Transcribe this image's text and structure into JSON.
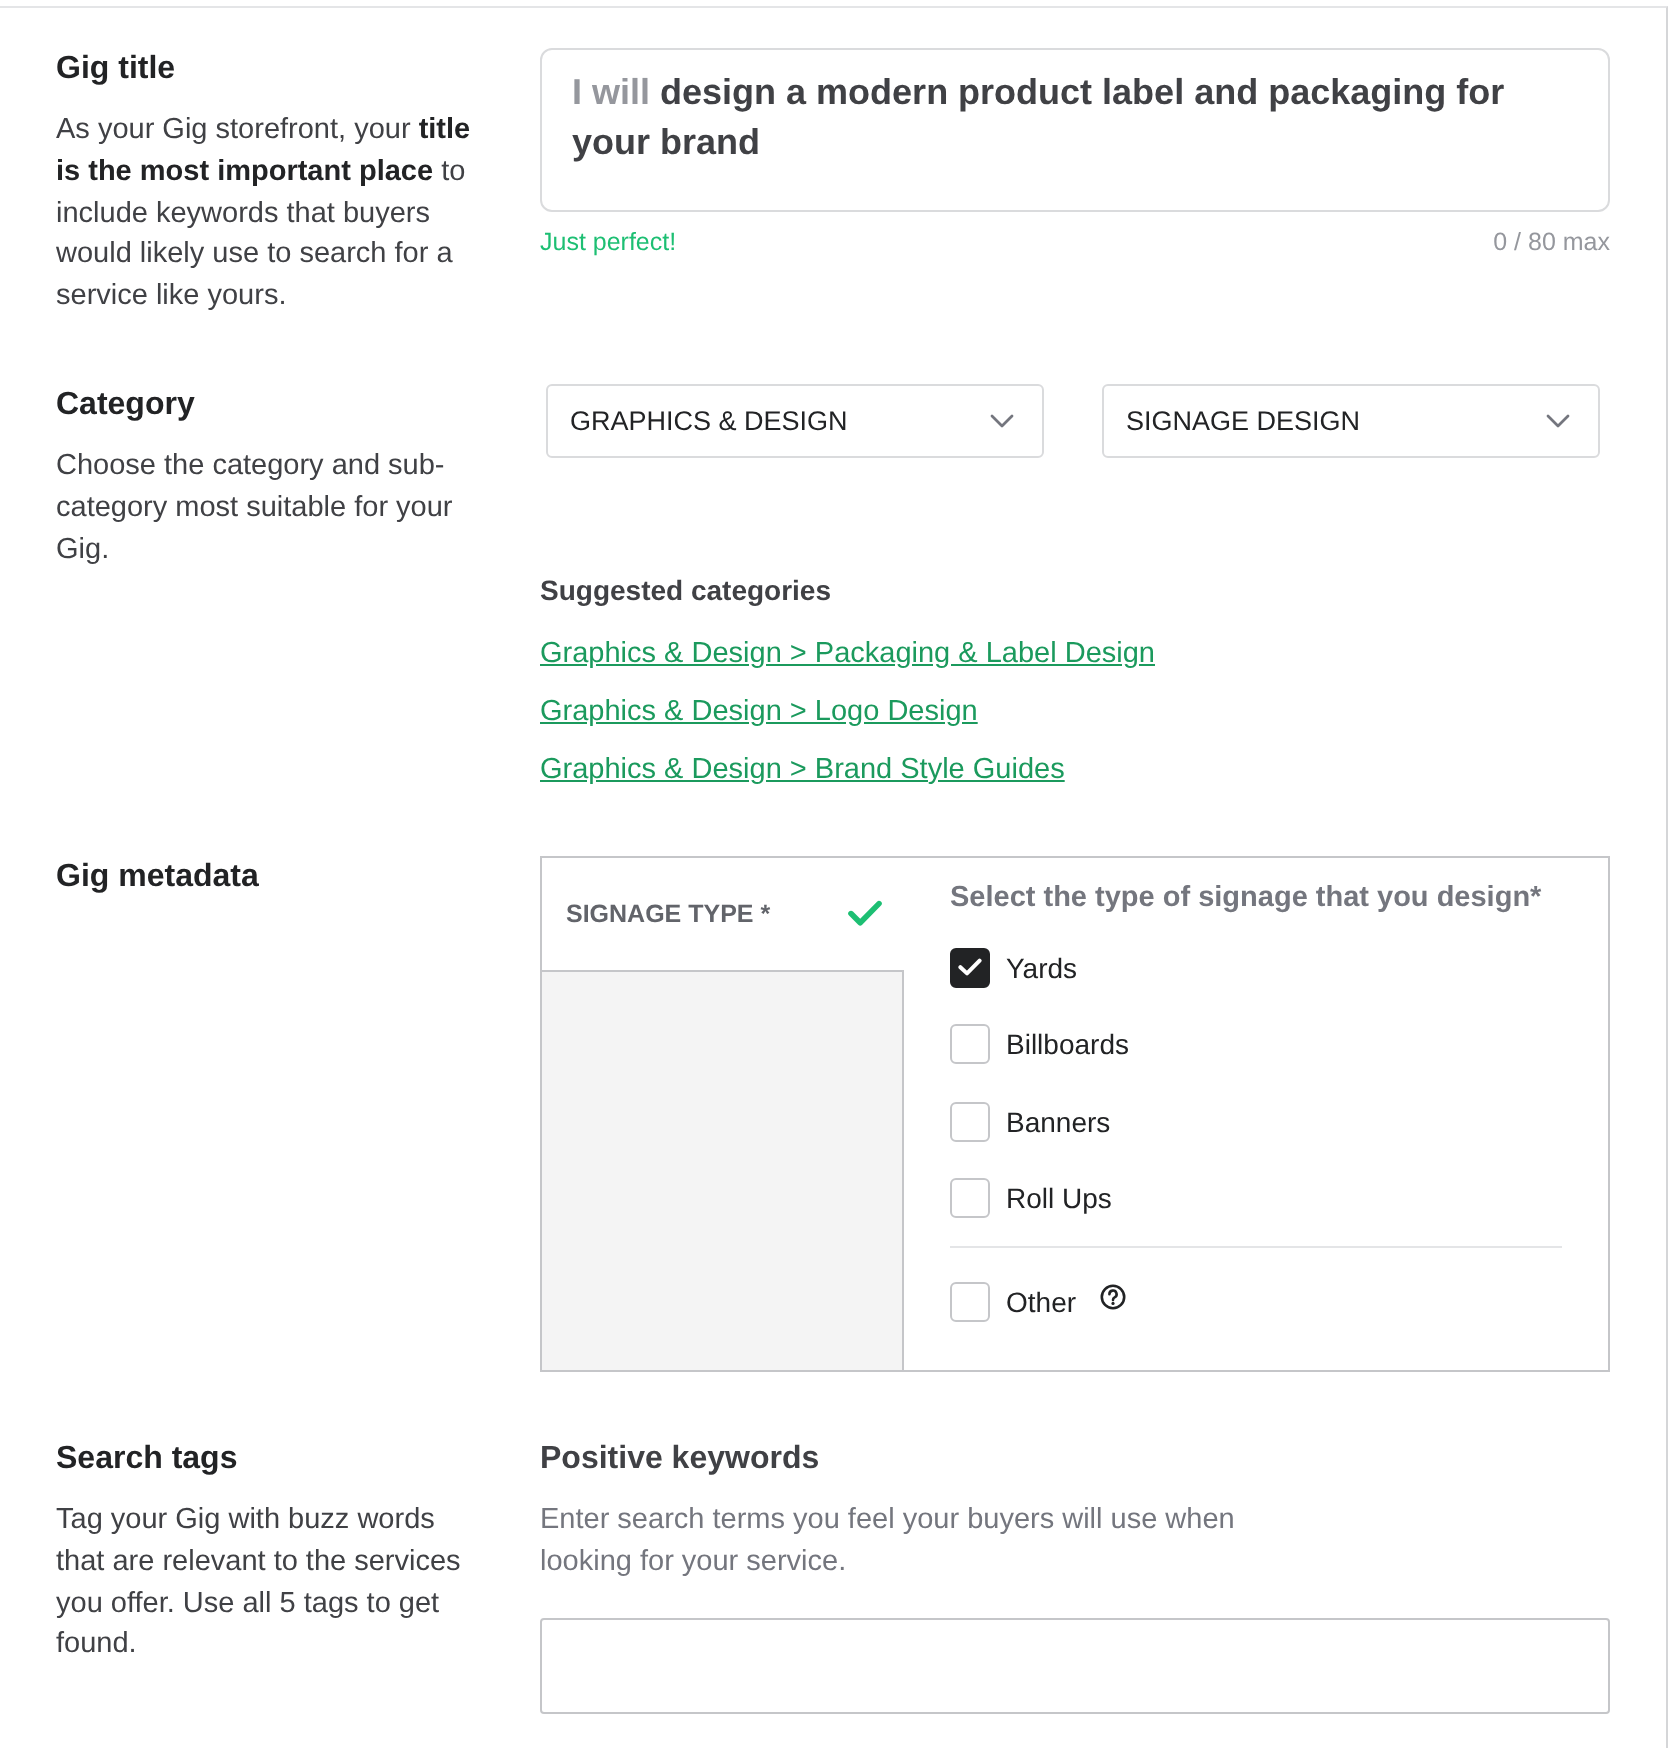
{
  "sections": [
    {
      "kind": "title",
      "heading": "Gig title",
      "description": "As your Gig storefront, your **title is the most important place** to include keywords that buyers would likely use to search for a service like yours.",
      "field": {
        "prefix": "I will",
        "value": "design a modern product label and packaging for your brand"
      },
      "hint": "Just perfect!",
      "counter": "0 / 80 max"
    },
    {
      "kind": "category",
      "heading": "Category",
      "description": "Choose the category and sub-category most suitable for your Gig.",
      "dropdowns": [
        {
          "value": "GRAPHICS & DESIGN"
        },
        {
          "value": "SIGNAGE DESIGN"
        }
      ],
      "suggested": {
        "title": "Suggested categories",
        "links": [
          "Graphics & Design > Packaging & Label Design",
          "Graphics & Design > Logo Design",
          "Graphics & Design > Brand Style Guides"
        ]
      }
    },
    {
      "kind": "metadata",
      "heading": "Gig metadata",
      "tabs": [
        {
          "label": "SIGNAGE TYPE *",
          "selected": true,
          "complete": true
        }
      ],
      "question": "Select the type of signage that you design*",
      "options": [
        {
          "kind": "option",
          "label": "Yards",
          "checked": true
        },
        {
          "kind": "option",
          "label": "Billboards",
          "checked": false
        },
        {
          "kind": "option",
          "label": "Banners",
          "checked": false
        },
        {
          "kind": "option",
          "label": "Roll Ups",
          "checked": false
        },
        {
          "kind": "other",
          "label": "Other",
          "checked": false
        }
      ]
    },
    {
      "kind": "tags",
      "heading": "Search tags",
      "description": "Tag your Gig with buzz words that are relevant to the services you offer. Use all 5 tags to get found.",
      "subheading": "Positive keywords",
      "subdescription": "Enter search terms you feel your buyers will use when looking for your service."
    }
  ]
}
